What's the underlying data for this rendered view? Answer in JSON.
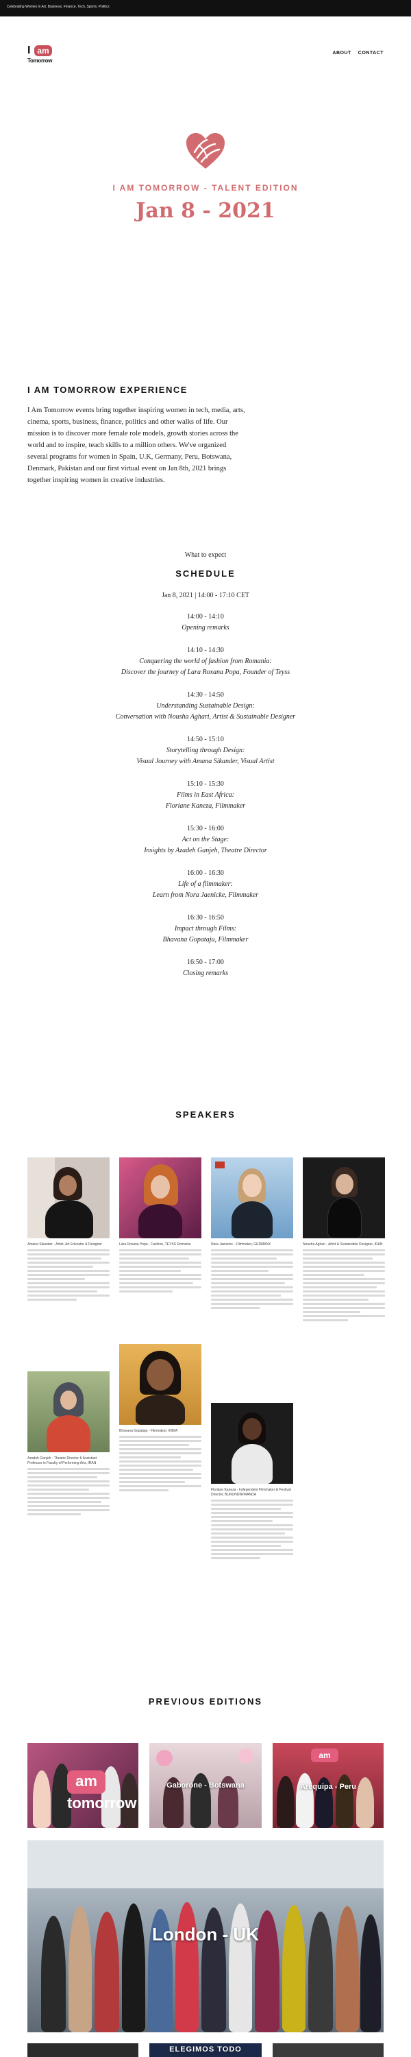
{
  "topbar": {
    "text": "Celebrating Women in Art, Business, Finance, Tech, Sports, Politics"
  },
  "logo": {
    "i": "I",
    "am": "am",
    "tomorrow": "Tomorrow"
  },
  "nav": {
    "about": "ABOUT",
    "contact": "CONTACT"
  },
  "event": {
    "subtitle": "I AM TOMORROW - TALENT EDITION",
    "date": "Jan 8 - 2021"
  },
  "experience": {
    "title": "I AM TOMORROW EXPERIENCE",
    "text": "I Am Tomorrow events bring together inspiring women in tech, media, arts, cinema, sports, business, finance, politics and other walks of life. Our mission is to discover more female role models, growth stories across the world and to inspire, teach skills to a million others. We've organized several programs for women in Spain, U.K, Germany, Peru, Botswana, Denmark, Pakistan and our first virtual event on Jan 8th, 2021 brings together inspiring women in creative industries."
  },
  "schedule": {
    "intro": "What to expect",
    "title": "SCHEDULE",
    "date": "Jan 8, 2021 | 14:00 - 17:10 CET",
    "slots": [
      {
        "time": "14:00 - 14:10",
        "lines": [
          "Opening remarks"
        ]
      },
      {
        "time": "14:10 - 14:30",
        "lines": [
          "Conquering the world of fashion from Romania:",
          "Discover the journey of Lara Roxana Popa, Founder of Teyss"
        ]
      },
      {
        "time": "14:30 - 14:50",
        "lines": [
          "Understanding Sustainable Design:",
          "Conversation with Nousha Aghari, Artist & Sustainable Designer"
        ]
      },
      {
        "time": "14:50 - 15:10",
        "lines": [
          "Storytelling through Design:",
          "Visual Journey with Amana Sikander, Visual Artist"
        ]
      },
      {
        "time": "15:10 - 15:30",
        "lines": [
          "Films in East Africa:",
          "Floriane Kaneza, Filmmaker"
        ]
      },
      {
        "time": "15:30 - 16:00",
        "lines": [
          "Act on the Stage:",
          "Insights by Azadeh Ganjeh, Theatre Director"
        ]
      },
      {
        "time": "16:00 - 16:30",
        "lines": [
          "Life of a filmmaker:",
          "Learn from Nora Jaenicke, Filmmaker"
        ]
      },
      {
        "time": "16:30 - 16:50",
        "lines": [
          "Impact through Films:",
          "Bhavana Gopataju, Filmmaker"
        ]
      },
      {
        "time": "16:50 - 17:00",
        "lines": [
          "Closing remarks"
        ]
      }
    ]
  },
  "speakers": {
    "title": "SPEAKERS",
    "items": [
      {
        "name": "Amana Sikander - Artist, Art Educator & Designer"
      },
      {
        "name": "Lara Roxana Popa - Fashion, TEYSS Romania"
      },
      {
        "name": "Nora Jaenicke - Filmmaker, GERMANY"
      },
      {
        "name": "Nousha Aghari - Artist & Sustainable Designer, IRAN"
      },
      {
        "name": "Azadeh Ganjeh - Theatre Director & Assistant Professor in Faculty of Performing Arts, IRAN"
      },
      {
        "name": "Bhavana Gopataju - Filmmaker, INDIA"
      },
      {
        "name": "Floriane Kaneza - Independent Filmmaker & Festival Director, BURUNDI/RWANDA"
      }
    ]
  },
  "previous": {
    "title": "PREVIOUS EDITIONS",
    "editions": [
      {
        "label": "",
        "logo": "am tomorrow"
      },
      {
        "label": "Gaborone - Botswana"
      },
      {
        "label": "Arequipa - Peru",
        "logo": "am"
      },
      {
        "label": "London - UK"
      }
    ],
    "bottom_banner": "ELEGIMOS TODO"
  },
  "colors": {
    "accent": "#d26b6f",
    "logo": "#c94f5a",
    "topbar": "#111111"
  }
}
